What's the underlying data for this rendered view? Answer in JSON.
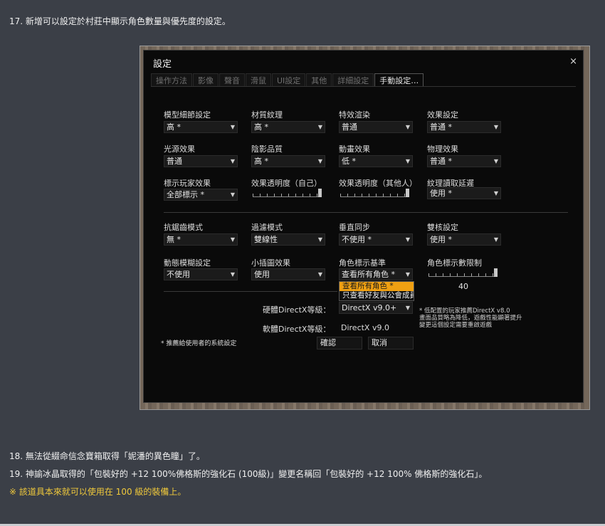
{
  "notes": {
    "n17": "17. 新增可以設定於村莊中顯示角色數量與優先度的設定。",
    "n18": "18. 無法從綴命信念寶箱取得「妮潘的異色瞳」了。",
    "n19": "19. 神諭冰晶取得的「包裝好的 +12 100%佛格斯的強化石 (100級)」變更名稱回「包裝好的 +12 100% 佛格斯的強化石」。",
    "n20": "※ 該道具本來就可以使用在 100 級的裝備上。"
  },
  "dialog": {
    "title": "設定",
    "close": "×",
    "tabs": [
      "操作方法",
      "影像",
      "聲音",
      "滑鼠",
      "UI設定",
      "其他",
      "詳細設定",
      "手動設定…"
    ],
    "active_tab": "手動設定…",
    "fields": {
      "model": {
        "label": "模型細節設定",
        "value": "高 *"
      },
      "texture": {
        "label": "材質紋理",
        "value": "高 *"
      },
      "effect_render": {
        "label": "特效渲染",
        "value": "普通"
      },
      "effect_setting": {
        "label": "效果設定",
        "value": "普通 *"
      },
      "light": {
        "label": "光源效果",
        "value": "普通"
      },
      "shadow": {
        "label": "陰影品質",
        "value": "高 *"
      },
      "motion": {
        "label": "動畫效果",
        "value": "低 *"
      },
      "physics": {
        "label": "物理效果",
        "value": "普通 *"
      },
      "player_effect": {
        "label": "標示玩家效果",
        "value": "全部標示 *"
      },
      "effect_alpha_self": {
        "label": "效果透明度（自己）",
        "level": 1.0
      },
      "effect_alpha_other": {
        "label": "效果透明度（其他人）",
        "level": 1.0
      },
      "texture_delay": {
        "label": "紋理讀取延遲",
        "value": "使用 *"
      },
      "aa": {
        "label": "抗鋸齒模式",
        "value": "無 *"
      },
      "filter": {
        "label": "過濾模式",
        "value": "雙線性"
      },
      "vsync": {
        "label": "垂直同步",
        "value": "不使用 *"
      },
      "dual_core": {
        "label": "雙核設定",
        "value": "使用 *"
      },
      "motion_blur": {
        "label": "動態模糊設定",
        "value": "不使用"
      },
      "minimap": {
        "label": "小插圖效果",
        "value": "使用"
      },
      "char_basis": {
        "label": "角色標示基準",
        "value": "查看所有角色 *"
      },
      "char_limit": {
        "label": "角色標示數限制",
        "value": "40",
        "level": 1.0
      }
    },
    "dropdown_options": [
      "查看所有角色 *",
      "只查看好友與公會成員"
    ],
    "hw_label": "硬體DirectX等級：",
    "hw_value": "DirectX v9.0+",
    "sw_label": "軟體DirectX等級：",
    "sw_value": "DirectX v9.0",
    "hint_lines": [
      "* 低配置的玩家推薦DirectX v8.0",
      "畫面品質略為降低，遊戲性能顯著提升",
      "變更這個設定需要重啟遊戲"
    ],
    "recommend_note": "* 推薦給使用者的系統設定",
    "confirm": "確認",
    "cancel": "取消"
  },
  "colors": {
    "page_bg": "#3b3f47",
    "dialog_bg": "#0a0a0a",
    "highlight": "#f0a012",
    "warn_text": "#f0c93b"
  }
}
